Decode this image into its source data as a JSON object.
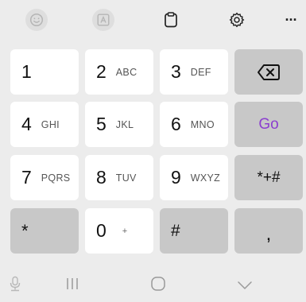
{
  "toolbar": {
    "items": [
      {
        "icon": "emoji-icon"
      },
      {
        "icon": "text-recognition-icon"
      },
      {
        "icon": "clipboard-icon"
      },
      {
        "icon": "settings-icon"
      },
      {
        "icon": "more-icon",
        "label": "···"
      }
    ]
  },
  "keys": {
    "k1": {
      "digit": "1",
      "letters": ""
    },
    "k2": {
      "digit": "2",
      "letters": "ABC"
    },
    "k3": {
      "digit": "3",
      "letters": "DEF"
    },
    "k4": {
      "digit": "4",
      "letters": "GHI"
    },
    "k5": {
      "digit": "5",
      "letters": "JKL"
    },
    "k6": {
      "digit": "6",
      "letters": "MNO"
    },
    "k7": {
      "digit": "7",
      "letters": "PQRS"
    },
    "k8": {
      "digit": "8",
      "letters": "TUV"
    },
    "k9": {
      "digit": "9",
      "letters": "WXYZ"
    },
    "k0": {
      "digit": "0",
      "letters": "+"
    },
    "star": "*",
    "hash": "#",
    "symbols": "*+#",
    "go": "Go",
    "comma": ",",
    "backspace_icon": "backspace-icon"
  },
  "colors": {
    "background": "#ececec",
    "key": "#ffffff",
    "function_key": "#c8c8c8",
    "go_text": "#8b3fcf"
  },
  "navbar": {
    "items": [
      "microphone-icon",
      "recent-apps-icon",
      "home-icon",
      "back-icon"
    ]
  }
}
